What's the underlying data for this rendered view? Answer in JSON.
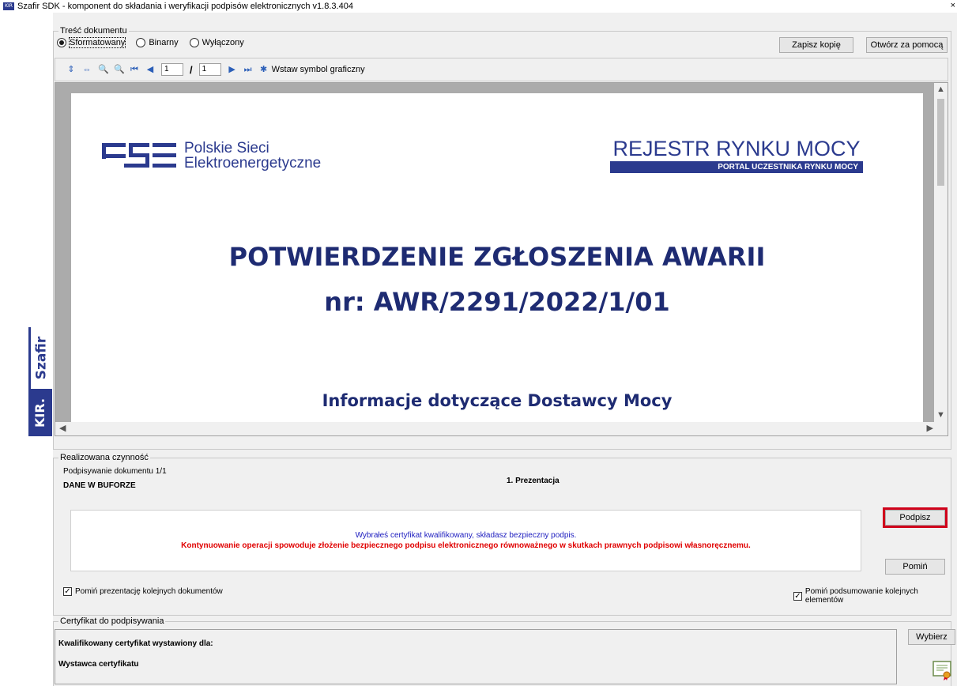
{
  "window": {
    "title": "Szafir SDK - komponent do składania i weryfikacji podpisów elektronicznych v1.8.3.404",
    "icon_text": "KIR",
    "close_glyph": "×"
  },
  "brand": {
    "szafir": "Szafir",
    "kir": "KIR."
  },
  "content_group": {
    "legend": "Treść dokumentu",
    "radios": [
      {
        "label": "Sformatowany",
        "selected": true
      },
      {
        "label": "Binarny",
        "selected": false
      },
      {
        "label": "Wyłączony",
        "selected": false
      }
    ],
    "save_copy": "Zapisz kopię",
    "open_with": "Otwórz za pomocą"
  },
  "toolbar": {
    "current_page": "1",
    "total_pages": "1",
    "insert_symbol": "Wstaw symbol graficzny"
  },
  "document": {
    "pse_line1": "Polskie Sieci",
    "pse_line2": "Elektroenergetyczne",
    "rrm_title": "REJESTR RYNKU MOCY",
    "rrm_subtitle": "PORTAL UCZESTNIKA RYNKU MOCY",
    "heading": "POTWIERDZENIE ZGŁOSZENIA AWARII",
    "number": "nr: AWR/2291/2022/1/01",
    "section": "Informacje dotyczące Dostawcy Mocy"
  },
  "action": {
    "legend": "Realizowana czynność",
    "progress": "Podpisywanie dokumentu 1/1",
    "buffer": "DANE W BUFORZE",
    "step": "1. Prezentacja",
    "msg_info": "Wybrałeś certyfikat kwalifikowany, składasz bezpieczny podpis.",
    "msg_warning": "Kontynuowanie operacji spowoduje złożenie bezpiecznego podpisu elektronicznego równoważnego w skutkach prawnych podpisowi własnoręcznemu.",
    "sign_button": "Podpisz",
    "skip_button": "Pomiń",
    "skip_presentation": "Pomiń prezentację kolejnych dokumentów",
    "skip_summary": "Pomiń podsumowanie kolejnych elementów"
  },
  "certificate": {
    "legend": "Certyfikat do podpisywania",
    "issued_for": "Kwalifikowany certyfikat wystawiony dla:",
    "issuer": "Wystawca certyfikatu",
    "choose_button": "Wybierz"
  },
  "colors": {
    "brand_blue": "#2b3a8e",
    "doc_heading": "#1e2b72",
    "warning_red": "#e00000",
    "info_blue": "#2020c0",
    "highlight_red": "#d0021b"
  }
}
